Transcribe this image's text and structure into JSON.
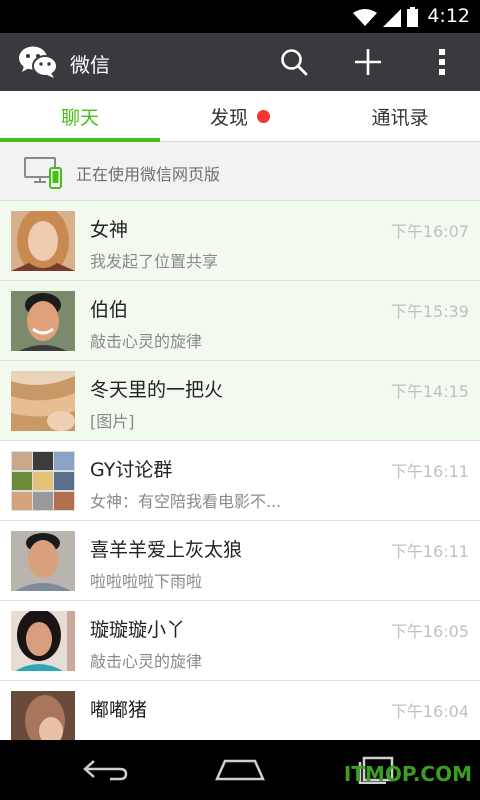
{
  "status_bar": {
    "time": "4:12",
    "icons": [
      "wifi-icon",
      "cell-signal-icon",
      "battery-icon"
    ]
  },
  "header": {
    "title": "微信",
    "logo_icon": "wechat-logo-icon",
    "actions": [
      "search-icon",
      "plus-icon",
      "overflow-menu-icon"
    ]
  },
  "tabs": {
    "items": [
      {
        "label": "聊天",
        "active": true
      },
      {
        "label": "发现",
        "badge": "red-dot"
      },
      {
        "label": "通讯录"
      }
    ]
  },
  "web_banner": {
    "text": "正在使用微信网页版",
    "icon": "desktop-phone-icon"
  },
  "chats": [
    {
      "name": "女神",
      "preview": "我发起了位置共享",
      "time": "下午16:07",
      "pinned": true
    },
    {
      "name": "伯伯",
      "preview": "敲击心灵的旋律",
      "time": "下午15:39",
      "pinned": true
    },
    {
      "name": "冬天里的一把火",
      "preview": "[图片]",
      "time": "下午14:15",
      "pinned": true
    },
    {
      "name": "GY讨论群",
      "preview": "女神：有空陪我看电影不...",
      "time": "下午16:11",
      "pinned": false
    },
    {
      "name": "喜羊羊爱上灰太狼",
      "preview": "啦啦啦啦下雨啦",
      "time": "下午16:11",
      "pinned": false
    },
    {
      "name": "璇璇璇小丫",
      "preview": "敲击心灵的旋律",
      "time": "下午16:05",
      "pinned": false
    },
    {
      "name": "嘟嘟猪",
      "preview": "。。。。。。。",
      "time": "下午16:04",
      "pinned": false
    }
  ],
  "nav_bar": {
    "buttons": [
      "back-icon",
      "home-icon",
      "recents-icon"
    ]
  },
  "watermark": "ITMOP.COM",
  "colors": {
    "accent": "#45c01a",
    "header_bg": "#393a3f",
    "badge": "#f43530",
    "pinned_bg": "#f2faf0"
  }
}
